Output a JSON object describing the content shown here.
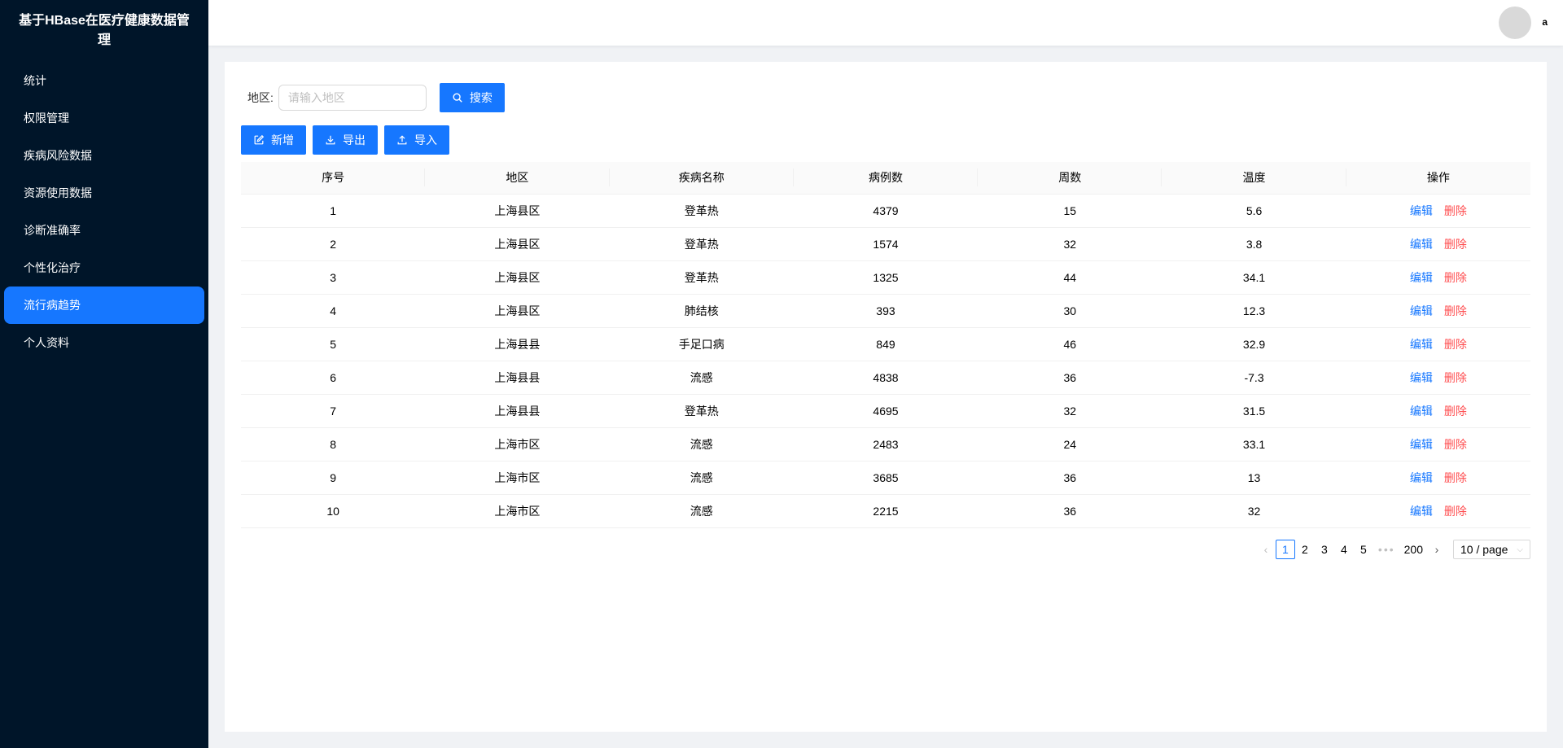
{
  "sidebar": {
    "brand": "基于HBase在医疗健康数据管理",
    "items": [
      {
        "label": "统计"
      },
      {
        "label": "权限管理"
      },
      {
        "label": "疾病风险数据"
      },
      {
        "label": "资源使用数据"
      },
      {
        "label": "诊断准确率"
      },
      {
        "label": "个性化治疗"
      },
      {
        "label": "流行病趋势"
      },
      {
        "label": "个人资料"
      }
    ],
    "active_index": 6
  },
  "header": {
    "username": "a"
  },
  "search": {
    "label": "地区:",
    "placeholder": "请输入地区",
    "value": "",
    "button": "搜索"
  },
  "actions": {
    "add": "新增",
    "export": "导出",
    "import": "导入"
  },
  "table": {
    "columns": [
      "序号",
      "地区",
      "疾病名称",
      "病例数",
      "周数",
      "温度",
      "操作"
    ],
    "rows": [
      [
        "1",
        "上海县区",
        "登革热",
        "4379",
        "15",
        "5.6"
      ],
      [
        "2",
        "上海县区",
        "登革热",
        "1574",
        "32",
        "3.8"
      ],
      [
        "3",
        "上海县区",
        "登革热",
        "1325",
        "44",
        "34.1"
      ],
      [
        "4",
        "上海县区",
        "肺结核",
        "393",
        "30",
        "12.3"
      ],
      [
        "5",
        "上海县县",
        "手足口病",
        "849",
        "46",
        "32.9"
      ],
      [
        "6",
        "上海县县",
        "流感",
        "4838",
        "36",
        "-7.3"
      ],
      [
        "7",
        "上海县县",
        "登革热",
        "4695",
        "32",
        "31.5"
      ],
      [
        "8",
        "上海市区",
        "流感",
        "2483",
        "24",
        "33.1"
      ],
      [
        "9",
        "上海市区",
        "流感",
        "3685",
        "36",
        "13"
      ],
      [
        "10",
        "上海市区",
        "流感",
        "2215",
        "36",
        "32"
      ]
    ],
    "edit_label": "编辑",
    "delete_label": "删除"
  },
  "pagination": {
    "pages": [
      "1",
      "2",
      "3",
      "4",
      "5"
    ],
    "current": "1",
    "dots": "•••",
    "last": "200",
    "page_size": "10 / page"
  },
  "colors": {
    "primary": "#1677ff",
    "sidebar_bg": "#001529",
    "danger": "#ff4d4f"
  }
}
